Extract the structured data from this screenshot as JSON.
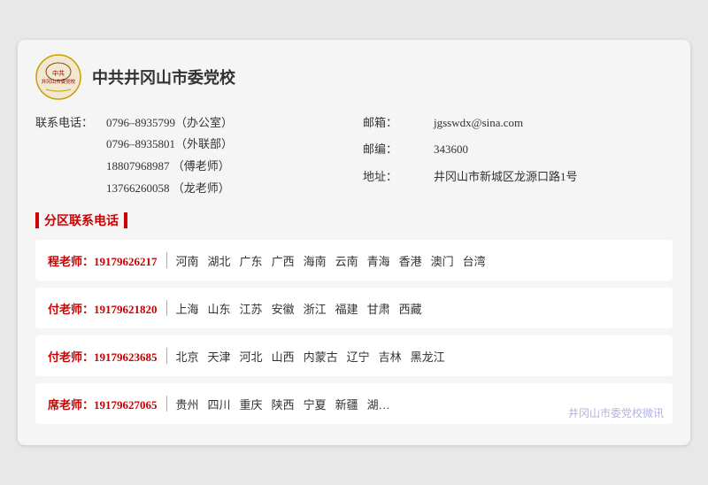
{
  "header": {
    "school_name": "中共井冈山市委党校"
  },
  "contacts": {
    "phone_label": "联系电话：",
    "phone_main": "0796–8935799（办公室）",
    "phone_ext1": "0796–8935801（外联部）",
    "phone_ext2": "18807968987 （傅老师）",
    "phone_ext3": "13766260058 （龙老师）",
    "email_label": "邮箱：",
    "email_value": "jgsswdx@sina.com",
    "postcode_label": "邮编：",
    "postcode_value": "343600",
    "address_label": "地址：",
    "address_value": "井冈山市新城区龙源口路1号"
  },
  "section_title": "分区联系电话",
  "regions": [
    {
      "teacher": "程老师：19179626217",
      "areas": [
        "河南",
        "湖北",
        "广东",
        "广西",
        "海南",
        "云南",
        "青海",
        "香港",
        "澳门",
        "台湾"
      ]
    },
    {
      "teacher": "付老师：19179621820",
      "areas": [
        "上海",
        "山东",
        "江苏",
        "安徽",
        "浙江",
        "福建",
        "甘肃",
        "西藏"
      ]
    },
    {
      "teacher": "付老师：19179623685",
      "areas": [
        "北京",
        "天津",
        "河北",
        "山西",
        "内蒙古",
        "辽宁",
        "吉林",
        "黑龙江"
      ]
    },
    {
      "teacher": "席老师：19179627065",
      "areas": [
        "贵州",
        "四川",
        "重庆",
        "陕西",
        "宁夏",
        "新疆",
        "湖…"
      ]
    }
  ],
  "watermark": "井冈山市委党校微讯"
}
